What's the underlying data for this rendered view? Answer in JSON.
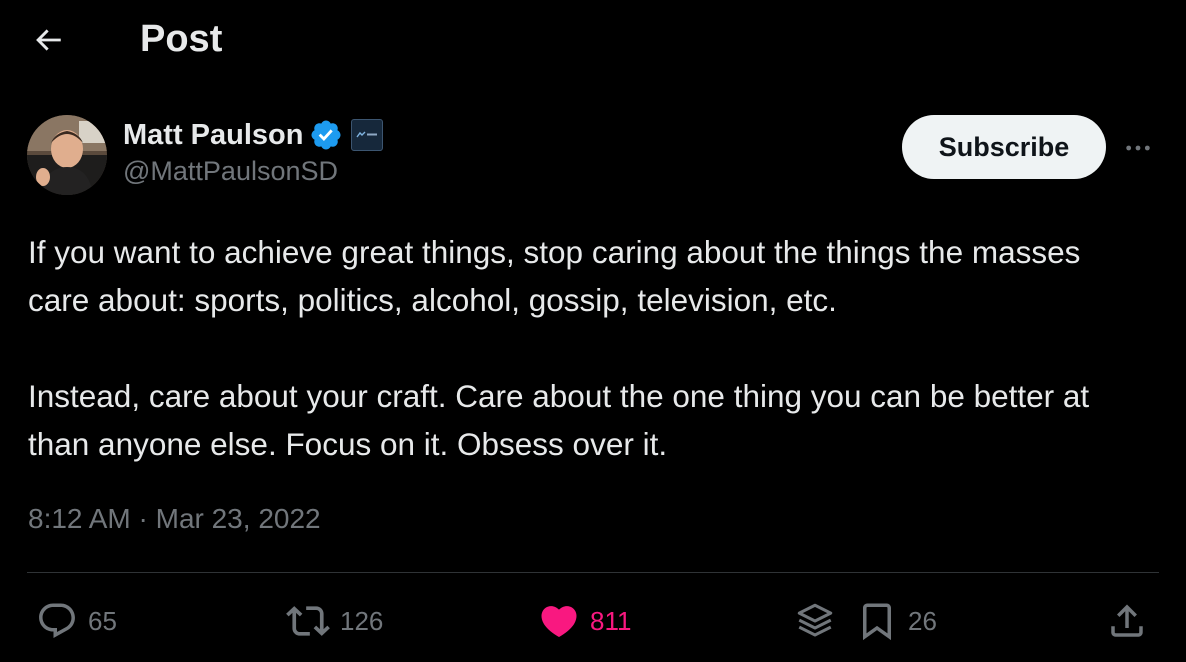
{
  "header": {
    "title": "Post",
    "back_icon": "arrow-left-icon"
  },
  "post": {
    "author": {
      "display_name": "Matt Paulson",
      "handle": "@MattPaulsonSD",
      "verified": true,
      "verified_icon": "verified-badge-icon",
      "affiliate_icon": "affiliate-badge-icon"
    },
    "subscribe_label": "Subscribe",
    "more_icon": "more-horizontal-icon",
    "text": {
      "paragraph_1": "If you want to achieve great things, stop caring about the things the masses care about: sports, politics, alcohol, gossip, television, etc.",
      "paragraph_2": "Instead, care about your craft. Care about the one thing you can be better at than anyone else. Focus on it. Obsess over it."
    },
    "timestamp": "8:12 AM · Mar 23, 2022"
  },
  "actions": {
    "reply": {
      "icon": "reply-icon",
      "count": "65"
    },
    "repost": {
      "icon": "repost-icon",
      "count": "126"
    },
    "like": {
      "icon": "heart-filled-icon",
      "count": "811",
      "active": true
    },
    "grok": {
      "icon": "grok-stack-icon"
    },
    "bookmark": {
      "icon": "bookmark-icon",
      "count": "26"
    },
    "share": {
      "icon": "share-icon"
    }
  },
  "colors": {
    "background": "#000000",
    "text_primary": "#e7e9ea",
    "text_secondary": "#71767b",
    "verified_blue": "#1d9bf0",
    "like_pink": "#f91880",
    "divider": "#2f3336",
    "subscribe_bg": "#eff3f4"
  }
}
